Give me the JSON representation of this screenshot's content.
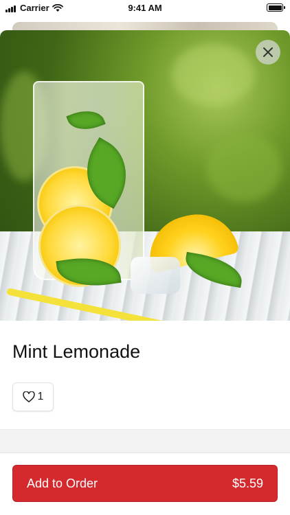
{
  "status_bar": {
    "carrier": "Carrier",
    "time": "9:41 AM"
  },
  "item": {
    "title": "Mint Lemonade",
    "likes": "1",
    "image_subject": "lemonade-glass-with-mint-and-lemon"
  },
  "order_button": {
    "label": "Add to Order",
    "price": "$5.59"
  },
  "colors": {
    "accent": "#d42a2e",
    "background": "#ffffff",
    "divider": "#f3f3f3"
  },
  "icons": {
    "close": "close-icon",
    "like": "heart-icon",
    "wifi": "wifi-icon",
    "signal": "signal-icon",
    "battery": "battery-icon"
  }
}
